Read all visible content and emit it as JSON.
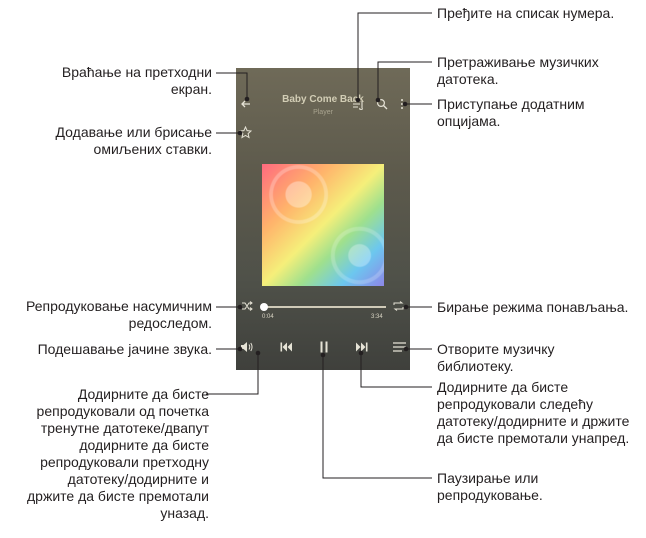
{
  "screen": {
    "song_title": "Baby Come Back",
    "song_subtitle": "Player",
    "time_elapsed": "0:04",
    "time_total": "3:34",
    "progress": 0.02
  },
  "icons": {
    "back": "arrow-left-icon",
    "playlist": "playlist-icon",
    "search": "search-icon",
    "more": "more-options-icon",
    "favorite": "star-icon",
    "shuffle": "shuffle-icon",
    "repeat": "repeat-icon",
    "volume": "volume-icon",
    "previous": "skip-back-icon",
    "pause": "pause-icon",
    "next": "skip-forward-icon",
    "library": "library-icon"
  },
  "callouts": {
    "playlist": "Пређите на списак нумера.",
    "search": "Претраживање музичких\nдатотека.",
    "back": "Враћање на претходни\nекран.",
    "more": "Приступање додатним\nопцијама.",
    "favorite": "Додавање или брисање\nомиљених ставки.",
    "shuffle": "Репродуковање насумичним\nредоследом.",
    "repeat": "Бирање режима понављања.",
    "volume": "Подешавање јачине звука.",
    "library": "Отворите музичку\nбиблиотеку.",
    "previous": "Додирните да бисте\nрепродуковали од почетка\nтренутне датотеке/двапут\nдодирните да бисте\nрепродуковали претходну\nдатотеку/додирните и\nдржите да бисте премотали\nуназад.",
    "next": "Додирните да бисте\nрепродуковали следећу\nдатотеку/додирните и држите\nда бисте премотали унапред.",
    "pause": "Паузирање или\nрепродуковање."
  },
  "colors": {
    "line": "#231f20",
    "dot": "#231f20"
  }
}
